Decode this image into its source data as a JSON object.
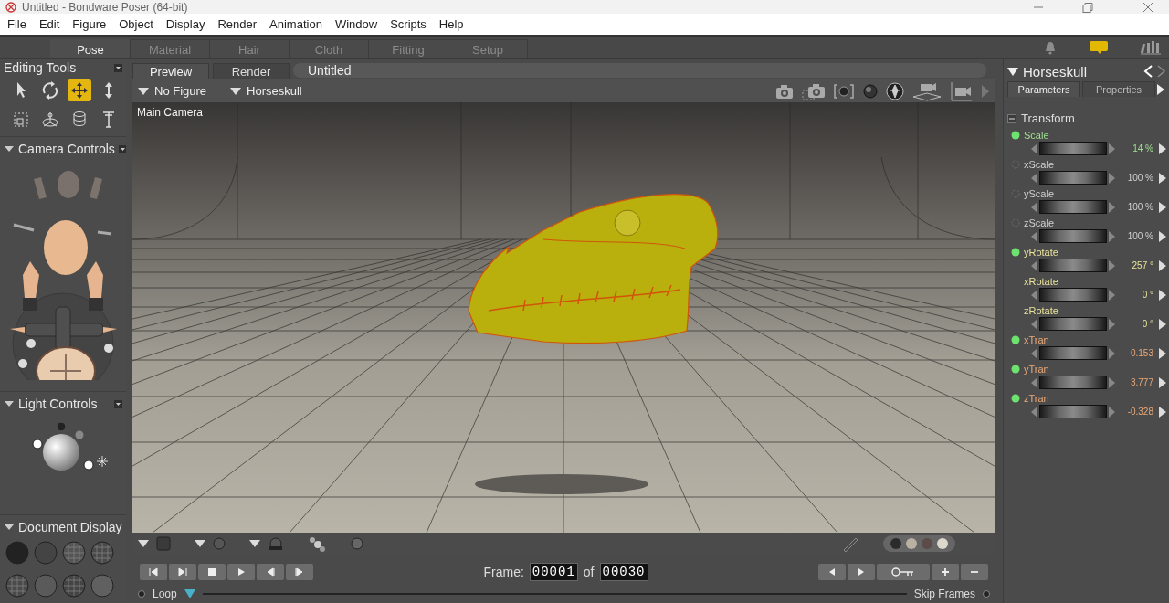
{
  "window": {
    "title": "Untitled - Bondware Poser (64-bit)"
  },
  "menu": [
    "File",
    "Edit",
    "Figure",
    "Object",
    "Display",
    "Render",
    "Animation",
    "Window",
    "Scripts",
    "Help"
  ],
  "rooms": [
    {
      "label": "Pose",
      "selected": true
    },
    {
      "label": "Material",
      "selected": false
    },
    {
      "label": "Hair",
      "selected": false
    },
    {
      "label": "Cloth",
      "selected": false
    },
    {
      "label": "Fitting",
      "selected": false
    },
    {
      "label": "Setup",
      "selected": false
    }
  ],
  "editing_tools": {
    "title": "Editing Tools",
    "tools": [
      {
        "kind": "pointer",
        "selected": false
      },
      {
        "kind": "rotate",
        "selected": false
      },
      {
        "kind": "translate",
        "selected": true
      },
      {
        "kind": "updown",
        "selected": false
      },
      {
        "kind": "frame",
        "selected": false
      },
      {
        "kind": "gizmo",
        "selected": false
      },
      {
        "kind": "stack",
        "selected": false
      },
      {
        "kind": "taper",
        "selected": false
      }
    ]
  },
  "camera_controls": {
    "title": "Camera Controls"
  },
  "light_controls": {
    "title": "Light Controls"
  },
  "document_display": {
    "title": "Document  Display"
  },
  "document": {
    "tabs": [
      {
        "label": "Preview",
        "selected": true
      },
      {
        "label": "Render",
        "selected": false
      }
    ],
    "title": "Untitled",
    "figure": "No Figure",
    "actor": "Horseskull",
    "camera": "Main Camera",
    "swatches": [
      {
        "color": "#2b2b2b"
      },
      {
        "color": "#b9b2a3"
      },
      {
        "color": "#5b4b49"
      },
      {
        "color": "#dcd8cc"
      }
    ]
  },
  "animation": {
    "frame_label": "Frame:",
    "frame": "00001",
    "of": "of",
    "total": "00030",
    "loop": "Loop",
    "skip": "Skip Frames"
  },
  "parameters": {
    "actor": "Horseskull",
    "tabs": [
      {
        "label": "Parameters",
        "selected": true
      },
      {
        "label": "Properties",
        "selected": false
      }
    ],
    "group": "Transform",
    "items": [
      {
        "name": "Scale",
        "value": "14 %",
        "color": "#9fe08f",
        "kind": "keyed"
      },
      {
        "name": "xScale",
        "value": "100 %",
        "color": "#d0d0d0",
        "kind": "unkeyed"
      },
      {
        "name": "yScale",
        "value": "100 %",
        "color": "#d0d0d0",
        "kind": "unkeyed"
      },
      {
        "name": "zScale",
        "value": "100 %",
        "color": "#d0d0d0",
        "kind": "unkeyed"
      },
      {
        "name": "yRotate",
        "value": "257 °",
        "color": "#e8e29a",
        "kind": "keyed"
      },
      {
        "name": "xRotate",
        "value": "0 °",
        "color": "#e8e29a",
        "kind": "plain"
      },
      {
        "name": "zRotate",
        "value": "0 °",
        "color": "#e8e29a",
        "kind": "plain"
      },
      {
        "name": "xTran",
        "value": "-0.153",
        "color": "#e8a878",
        "kind": "keyed"
      },
      {
        "name": "yTran",
        "value": "3.777",
        "color": "#e8a878",
        "kind": "keyed"
      },
      {
        "name": "zTran",
        "value": "-0.328",
        "color": "#e8a878",
        "kind": "keyed"
      }
    ]
  }
}
